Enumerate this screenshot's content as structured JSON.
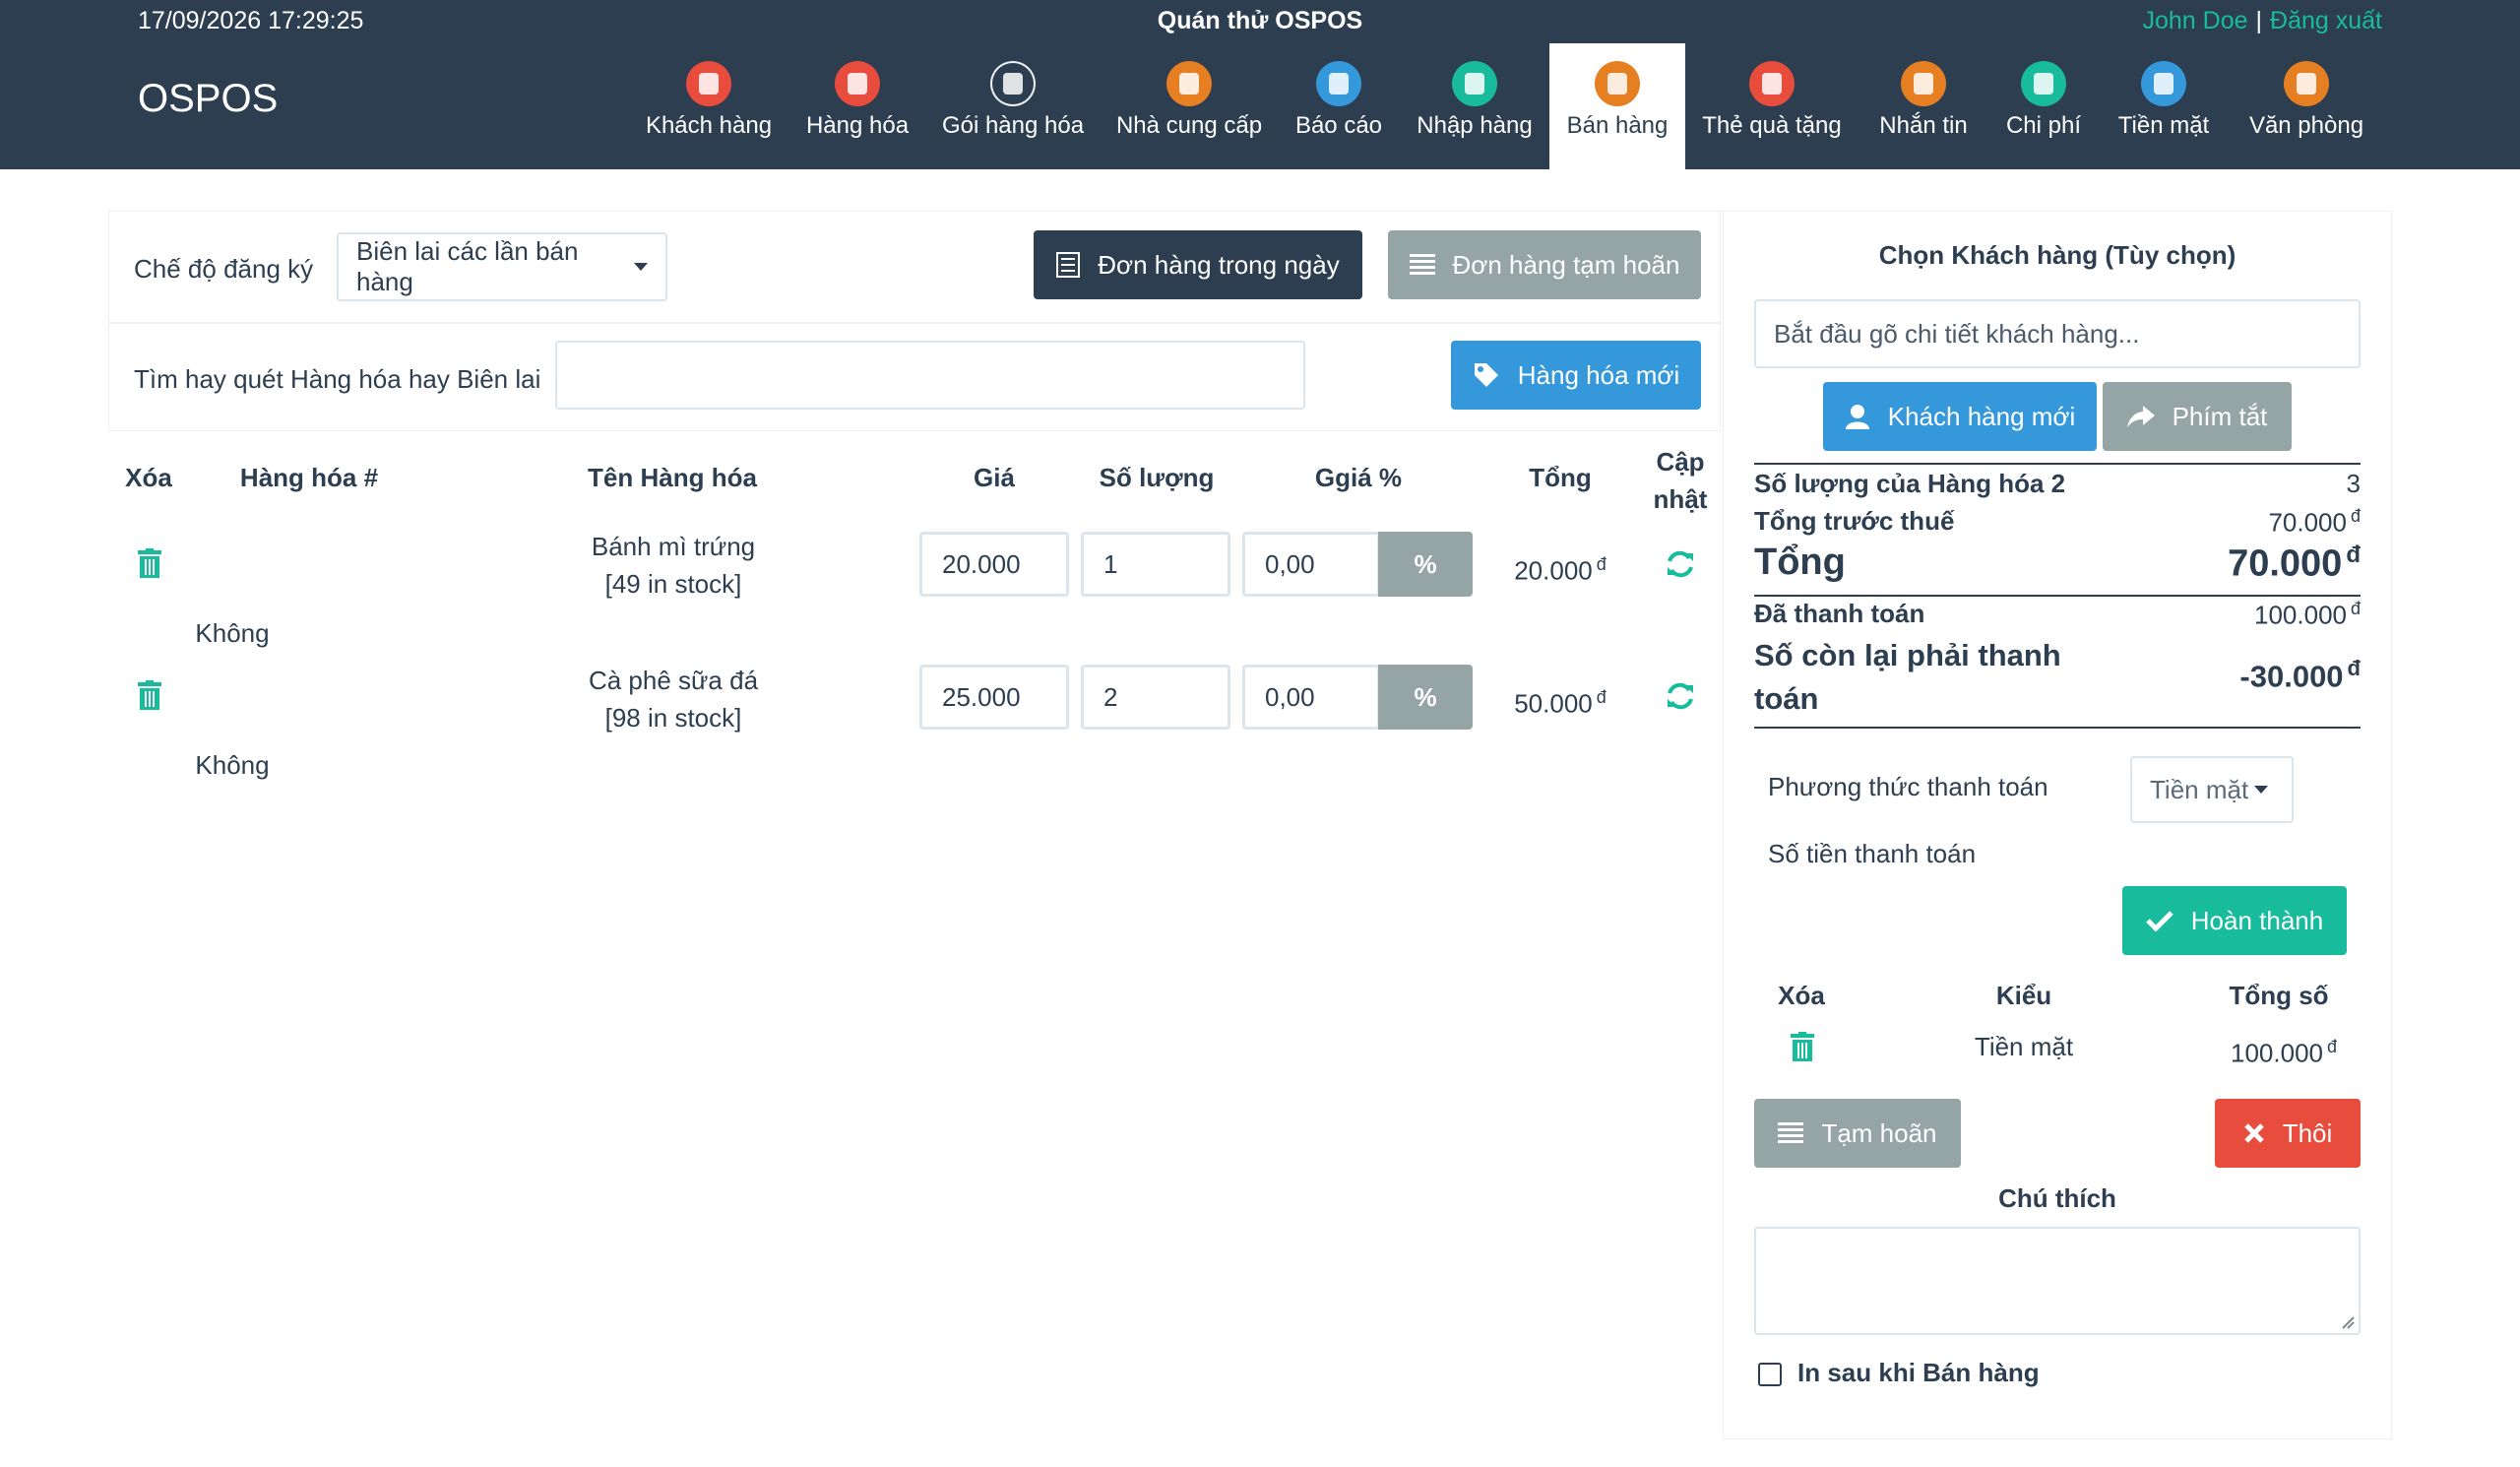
{
  "topbar": {
    "datetime": "17/09/2026 17:29:25",
    "title": "Quán thử OSPOS",
    "user": "John Doe",
    "separator": "|",
    "logout": "Đăng xuất"
  },
  "brand": "OSPOS",
  "nav": [
    {
      "label": "Khách hàng",
      "icon": "customers-icon",
      "color": "#e74c3c"
    },
    {
      "label": "Hàng hóa",
      "icon": "items-icon",
      "color": "#e74c3c"
    },
    {
      "label": "Gói hàng hóa",
      "icon": "item-kits-icon",
      "color": "#2c3e50"
    },
    {
      "label": "Nhà cung cấp",
      "icon": "suppliers-icon",
      "color": "#e67e22"
    },
    {
      "label": "Báo cáo",
      "icon": "reports-icon",
      "color": "#3498db"
    },
    {
      "label": "Nhập hàng",
      "icon": "receivings-icon",
      "color": "#18bc9c"
    },
    {
      "label": "Bán hàng",
      "icon": "sales-icon",
      "color": "#e67e22",
      "active": true
    },
    {
      "label": "Thẻ quà tặng",
      "icon": "giftcards-icon",
      "color": "#e74c3c"
    },
    {
      "label": "Nhắn tin",
      "icon": "messages-icon",
      "color": "#e67e22"
    },
    {
      "label": "Chi phí",
      "icon": "expenses-icon",
      "color": "#18bc9c"
    },
    {
      "label": "Tiền mặt",
      "icon": "cashups-icon",
      "color": "#3498db"
    },
    {
      "label": "Văn phòng",
      "icon": "office-icon",
      "color": "#e67e22"
    }
  ],
  "register": {
    "mode_label": "Chế độ đăng ký",
    "mode_value": "Biên lai các lần bán hàng",
    "daily_sales_btn": "Đơn hàng trong ngày",
    "suspended_btn": "Đơn hàng tạm hoãn",
    "search_label": "Tìm hay quét Hàng hóa hay Biên lai",
    "search_value": "",
    "new_item_btn": "Hàng hóa mới"
  },
  "cart": {
    "headers": {
      "delete": "Xóa",
      "item_no": "Hàng hóa #",
      "name": "Tên Hàng hóa",
      "price": "Giá",
      "qty": "Số lượng",
      "discount": "Ggiá %",
      "total": "Tổng",
      "update_1": "Cập",
      "update_2": "nhật"
    },
    "rows": [
      {
        "name": "Bánh mì trứng",
        "stock": "[49 in stock]",
        "price": "20.000",
        "qty": "1",
        "discount": "0,00",
        "pct": "%",
        "total": "20.000",
        "currency": "đ",
        "note": "Không"
      },
      {
        "name": "Cà phê sữa đá",
        "stock": "[98 in stock]",
        "price": "25.000",
        "qty": "2",
        "discount": "0,00",
        "pct": "%",
        "total": "50.000",
        "currency": "đ",
        "note": "Không"
      }
    ]
  },
  "customer": {
    "title": "Chọn Khách hàng (Tùy chọn)",
    "placeholder": "Bắt đầu gõ chi tiết khách hàng...",
    "new_customer_btn": "Khách hàng mới",
    "shortcuts_btn": "Phím tắt"
  },
  "summary": {
    "item_count_label": "Số lượng của Hàng hóa 2",
    "item_count": "3",
    "subtotal_label": "Tổng trước thuế",
    "subtotal": "70.000",
    "total_label": "Tổng",
    "total": "70.000",
    "paid_label": "Đã thanh toán",
    "paid": "100.000",
    "due_label_1": "Số còn lại phải thanh",
    "due_label_2": "toán",
    "due": "-30.000",
    "currency": "đ"
  },
  "payment": {
    "method_label": "Phương thức thanh toán",
    "method_value": "Tiền mặt",
    "amount_label": "Số tiền thanh toán",
    "complete_btn": "Hoàn thành",
    "headers": {
      "delete": "Xóa",
      "type": "Kiểu",
      "amount": "Tổng số"
    },
    "rows": [
      {
        "type": "Tiền mặt",
        "amount": "100.000",
        "currency": "đ"
      }
    ]
  },
  "actions": {
    "suspend_btn": "Tạm hoãn",
    "cancel_btn": "Thôi"
  },
  "comment": {
    "label": "Chú thích",
    "value": ""
  },
  "print_after_sale": {
    "label": "In sau khi Bán hàng",
    "checked": false
  }
}
